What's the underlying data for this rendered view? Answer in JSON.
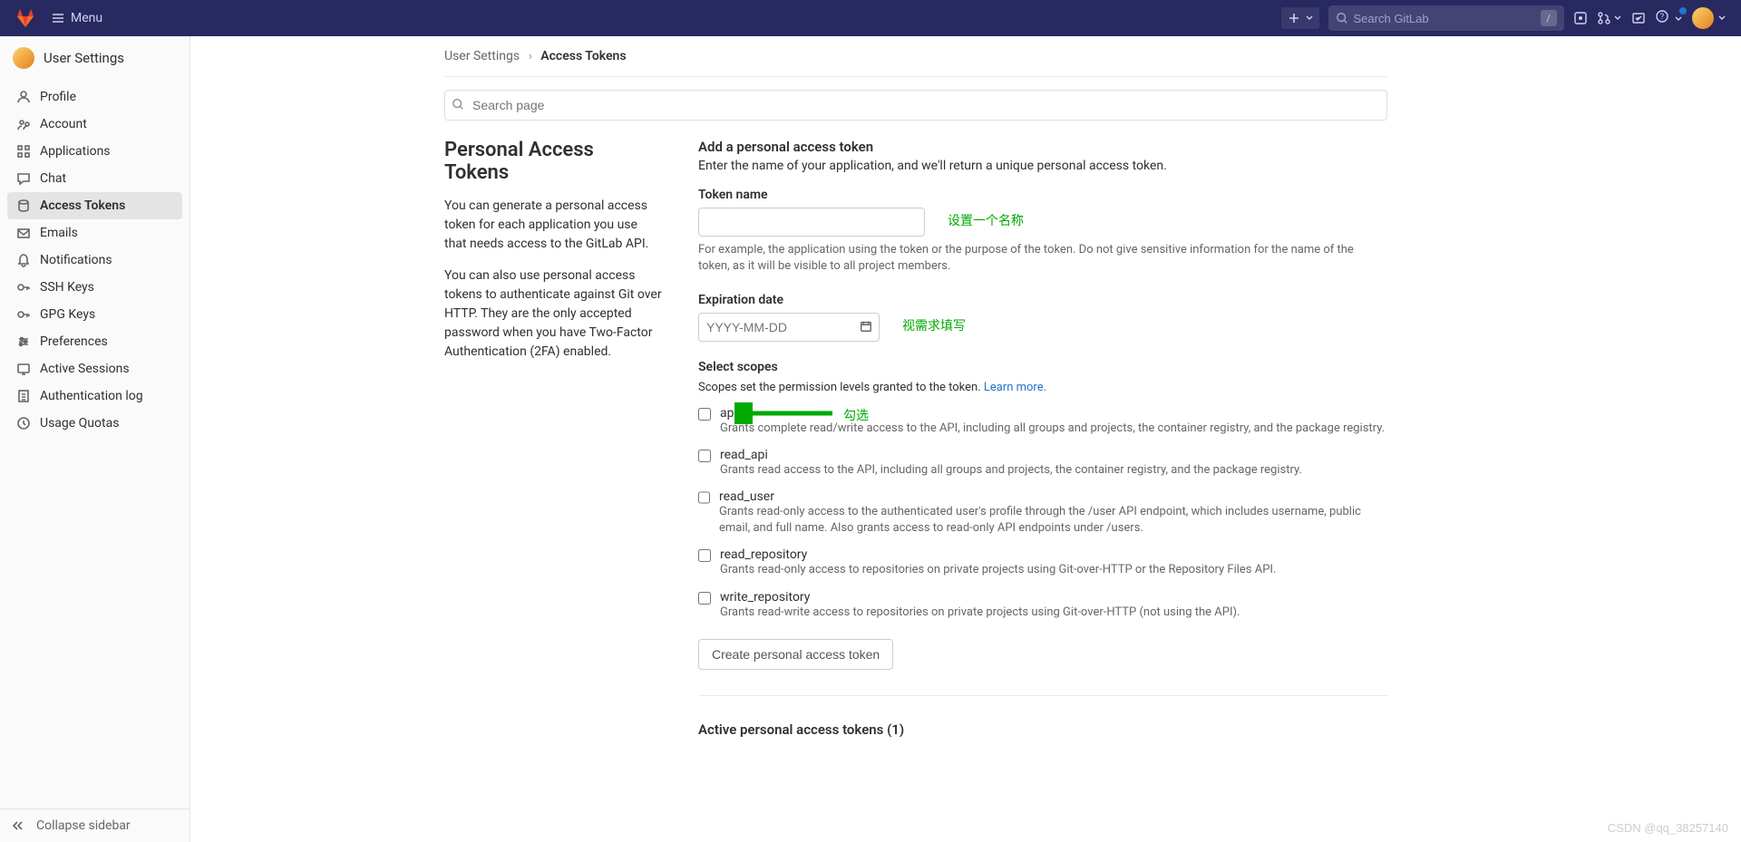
{
  "topbar": {
    "menu_label": "Menu",
    "search_placeholder": "Search GitLab",
    "search_kbd": "/"
  },
  "sidebar": {
    "title": "User Settings",
    "items": [
      {
        "label": "Profile",
        "icon": "profile"
      },
      {
        "label": "Account",
        "icon": "account"
      },
      {
        "label": "Applications",
        "icon": "apps"
      },
      {
        "label": "Chat",
        "icon": "chat"
      },
      {
        "label": "Access Tokens",
        "icon": "token",
        "active": true
      },
      {
        "label": "Emails",
        "icon": "mail"
      },
      {
        "label": "Notifications",
        "icon": "bell"
      },
      {
        "label": "SSH Keys",
        "icon": "key"
      },
      {
        "label": "GPG Keys",
        "icon": "key"
      },
      {
        "label": "Preferences",
        "icon": "prefs"
      },
      {
        "label": "Active Sessions",
        "icon": "session"
      },
      {
        "label": "Authentication log",
        "icon": "log"
      },
      {
        "label": "Usage Quotas",
        "icon": "quota"
      }
    ],
    "collapse_label": "Collapse sidebar"
  },
  "breadcrumb": {
    "root": "User Settings",
    "current": "Access Tokens"
  },
  "page_search_placeholder": "Search page",
  "left_col": {
    "title": "Personal Access Tokens",
    "p1": "You can generate a personal access token for each application you use that needs access to the GitLab API.",
    "p2": "You can also use personal access tokens to authenticate against Git over HTTP. They are the only accepted password when you have Two-Factor Authentication (2FA) enabled."
  },
  "form": {
    "add_title": "Add a personal access token",
    "add_sub": "Enter the name of your application, and we'll return a unique personal access token.",
    "name_label": "Token name",
    "name_help": "For example, the application using the token or the purpose of the token. Do not give sensitive information for the name of the token, as it will be visible to all project members.",
    "exp_label": "Expiration date",
    "exp_placeholder": "YYYY-MM-DD",
    "scopes_label": "Select scopes",
    "scopes_help": "Scopes set the permission levels granted to the token. ",
    "learn_more": "Learn more.",
    "scopes": [
      {
        "name": "api",
        "desc": "Grants complete read/write access to the API, including all groups and projects, the container registry, and the package registry."
      },
      {
        "name": "read_api",
        "desc": "Grants read access to the API, including all groups and projects, the container registry, and the package registry."
      },
      {
        "name": "read_user",
        "desc": "Grants read-only access to the authenticated user's profile through the /user API endpoint, which includes username, public email, and full name. Also grants access to read-only API endpoints under /users."
      },
      {
        "name": "read_repository",
        "desc": "Grants read-only access to repositories on private projects using Git-over-HTTP or the Repository Files API."
      },
      {
        "name": "write_repository",
        "desc": "Grants read-write access to repositories on private projects using Git-over-HTTP (not using the API)."
      }
    ],
    "create_btn": "Create personal access token"
  },
  "active_tokens_title": "Active personal access tokens (1)",
  "annotations": {
    "name": "设置一个名称",
    "date": "视需求填写",
    "scope": "勾选"
  },
  "watermark": "CSDN @qq_38257140"
}
